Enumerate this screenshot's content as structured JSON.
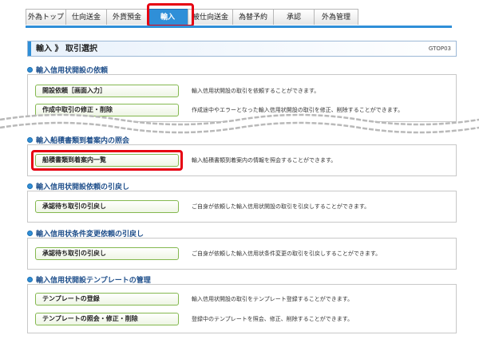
{
  "tabs": [
    {
      "label": "外為トップ",
      "active": false
    },
    {
      "label": "仕向送金",
      "active": false
    },
    {
      "label": "外貨預金",
      "active": false
    },
    {
      "label": "輸入",
      "active": true
    },
    {
      "label": "被仕向送金",
      "active": false
    },
    {
      "label": "為替予約",
      "active": false
    },
    {
      "label": "承認",
      "active": false
    },
    {
      "label": "外為管理",
      "active": false
    }
  ],
  "page": {
    "title": "輸入 》 取引選択",
    "code": "GTOP03"
  },
  "sections": [
    {
      "title": "輸入信用状開設の依頼",
      "items": [
        {
          "label": "開設依頼［画面入力］",
          "desc": "輸入信用状開設の取引を依頼することができます。"
        },
        {
          "label": "作成中取引の修正・削除",
          "desc": "作成途中やエラーとなった輸入信用状開設の取引を修正、削除することができます。"
        }
      ]
    },
    {
      "title": "輸入船積書類到着案内の照会",
      "items": [
        {
          "label": "船積書類到着案内一覧",
          "desc": "輸入船積書類到着案内の情報を照会することができます。"
        }
      ]
    },
    {
      "title": "輸入信用状開設依頼の引戻し",
      "items": [
        {
          "label": "承認待ち取引の引戻し",
          "desc": "ご自身が依頼した輸入信用状開設の取引を引戻しすることができます。"
        }
      ]
    },
    {
      "title": "輸入信用状条件変更依頼の引戻し",
      "items": [
        {
          "label": "承認待ち取引の引戻し",
          "desc": "ご自身が依頼した輸入信用状条件変更の取引を引戻しすることができます。"
        }
      ]
    },
    {
      "title": "輸入信用状開設テンプレートの管理",
      "items": [
        {
          "label": "テンプレートの登録",
          "desc": "輸入信用状開設の取引をテンプレート登録することができます。"
        },
        {
          "label": "テンプレートの照会・修正・削除",
          "desc": "登録中のテンプレートを照会、修正、削除することができます。"
        }
      ]
    }
  ],
  "colors": {
    "accent": "#2f8fd8",
    "highlight": "#e60012",
    "button_border": "#84b84f"
  }
}
